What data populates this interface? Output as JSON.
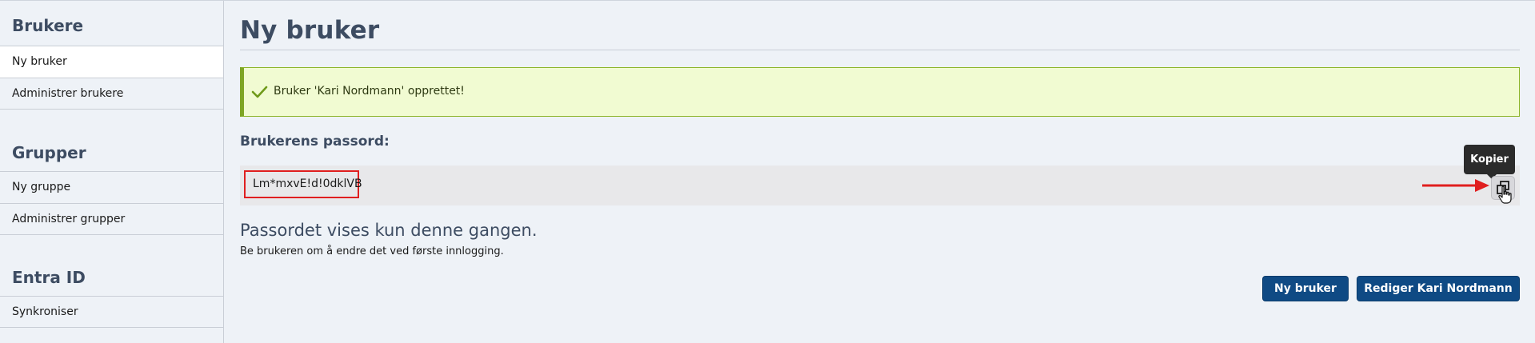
{
  "sidebar": {
    "sections": [
      {
        "heading": "Brukere",
        "items": [
          {
            "label": "Ny bruker"
          },
          {
            "label": "Administrer brukere"
          }
        ]
      },
      {
        "heading": "Grupper",
        "items": [
          {
            "label": "Ny gruppe"
          },
          {
            "label": "Administrer grupper"
          }
        ]
      },
      {
        "heading": "Entra ID",
        "items": [
          {
            "label": "Synkroniser"
          }
        ]
      }
    ]
  },
  "main": {
    "title": "Ny bruker",
    "alert": {
      "text": "Bruker 'Kari Nordmann' opprettet!",
      "icon": "check-icon",
      "color": "#7ea525"
    },
    "password_label": "Brukerens passord:",
    "password_value": "Lm*mxvE!d!0dklVB",
    "copy_tooltip": "Kopier",
    "copy_icon": "copy-icon",
    "notice_title": "Passordet vises kun denne gangen.",
    "notice_sub": "Be brukeren om å endre det ved første innlogging.",
    "buttons": {
      "new_user": "Ny bruker",
      "edit_user": "Rediger Kari Nordmann"
    }
  },
  "colors": {
    "primary": "#0f4a84",
    "heading": "#3d4c62",
    "highlight": "#e01f1f"
  }
}
